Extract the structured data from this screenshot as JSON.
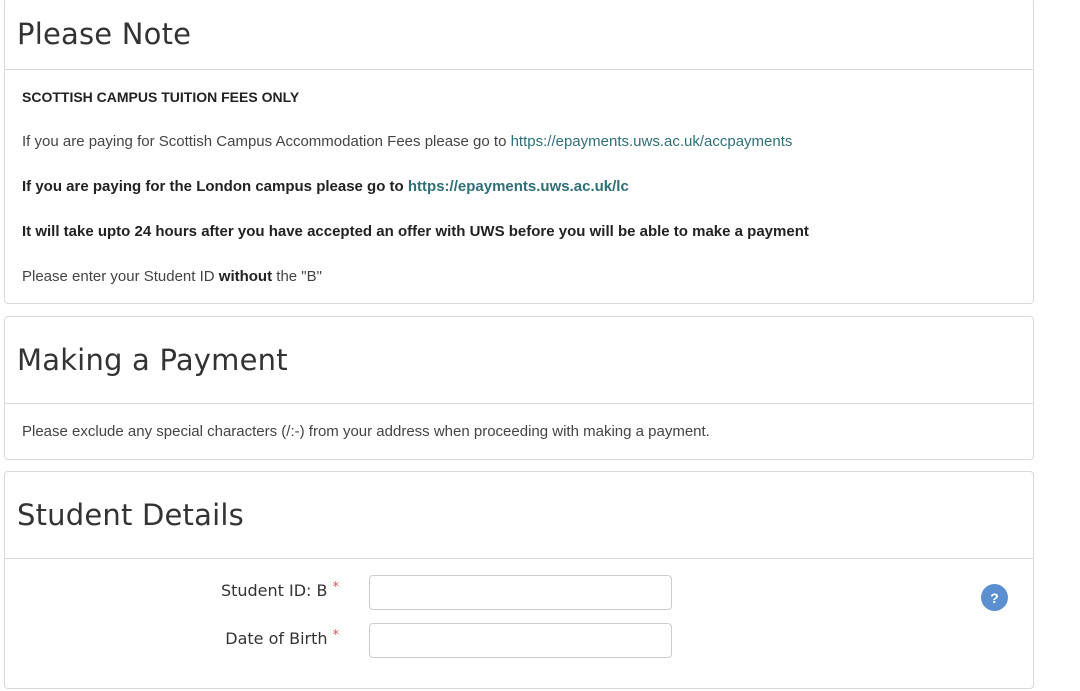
{
  "note": {
    "title": "Please Note",
    "heading_caps": "SCOTTISH CAMPUS TUITION FEES ONLY",
    "accommodation_text": "If you are paying for Scottish Campus Accommodation Fees please go to ",
    "accommodation_link": "https://epayments.uws.ac.uk/accpayments",
    "london_text": "If you are paying for the London campus please go to ",
    "london_link": "https://epayments.uws.ac.uk/lc",
    "offer_text": "It will take upto 24 hours after you have accepted an offer with UWS before you will be able to make a payment",
    "id_prefix": "Please enter your Student ID ",
    "id_bold": "without",
    "id_suffix": " the \"B\""
  },
  "payment": {
    "title": "Making a Payment",
    "text": "Please exclude any special characters (/:-) from your address when proceeding with making a payment."
  },
  "student": {
    "title": "Student Details",
    "id_label": "Student ID: B",
    "dob_label": "Date of Birth",
    "required_mark": "*",
    "id_value": "",
    "dob_value": "",
    "help_label": "?"
  }
}
